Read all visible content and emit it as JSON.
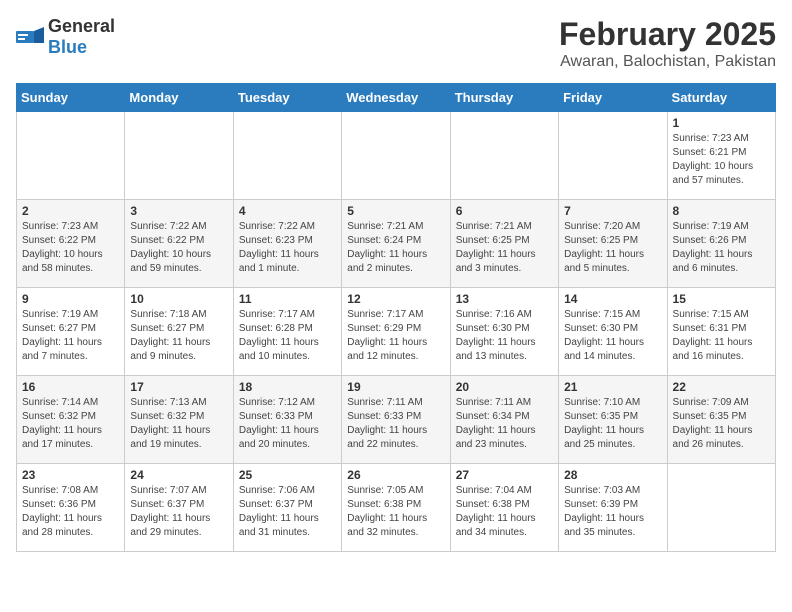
{
  "header": {
    "logo_general": "General",
    "logo_blue": "Blue",
    "main_title": "February 2025",
    "sub_title": "Awaran, Balochistan, Pakistan"
  },
  "weekdays": [
    "Sunday",
    "Monday",
    "Tuesday",
    "Wednesday",
    "Thursday",
    "Friday",
    "Saturday"
  ],
  "weeks": [
    [
      {
        "day": "",
        "info": ""
      },
      {
        "day": "",
        "info": ""
      },
      {
        "day": "",
        "info": ""
      },
      {
        "day": "",
        "info": ""
      },
      {
        "day": "",
        "info": ""
      },
      {
        "day": "",
        "info": ""
      },
      {
        "day": "1",
        "info": "Sunrise: 7:23 AM\nSunset: 6:21 PM\nDaylight: 10 hours\nand 57 minutes."
      }
    ],
    [
      {
        "day": "2",
        "info": "Sunrise: 7:23 AM\nSunset: 6:22 PM\nDaylight: 10 hours\nand 58 minutes."
      },
      {
        "day": "3",
        "info": "Sunrise: 7:22 AM\nSunset: 6:22 PM\nDaylight: 10 hours\nand 59 minutes."
      },
      {
        "day": "4",
        "info": "Sunrise: 7:22 AM\nSunset: 6:23 PM\nDaylight: 11 hours\nand 1 minute."
      },
      {
        "day": "5",
        "info": "Sunrise: 7:21 AM\nSunset: 6:24 PM\nDaylight: 11 hours\nand 2 minutes."
      },
      {
        "day": "6",
        "info": "Sunrise: 7:21 AM\nSunset: 6:25 PM\nDaylight: 11 hours\nand 3 minutes."
      },
      {
        "day": "7",
        "info": "Sunrise: 7:20 AM\nSunset: 6:25 PM\nDaylight: 11 hours\nand 5 minutes."
      },
      {
        "day": "8",
        "info": "Sunrise: 7:19 AM\nSunset: 6:26 PM\nDaylight: 11 hours\nand 6 minutes."
      }
    ],
    [
      {
        "day": "9",
        "info": "Sunrise: 7:19 AM\nSunset: 6:27 PM\nDaylight: 11 hours\nand 7 minutes."
      },
      {
        "day": "10",
        "info": "Sunrise: 7:18 AM\nSunset: 6:27 PM\nDaylight: 11 hours\nand 9 minutes."
      },
      {
        "day": "11",
        "info": "Sunrise: 7:17 AM\nSunset: 6:28 PM\nDaylight: 11 hours\nand 10 minutes."
      },
      {
        "day": "12",
        "info": "Sunrise: 7:17 AM\nSunset: 6:29 PM\nDaylight: 11 hours\nand 12 minutes."
      },
      {
        "day": "13",
        "info": "Sunrise: 7:16 AM\nSunset: 6:30 PM\nDaylight: 11 hours\nand 13 minutes."
      },
      {
        "day": "14",
        "info": "Sunrise: 7:15 AM\nSunset: 6:30 PM\nDaylight: 11 hours\nand 14 minutes."
      },
      {
        "day": "15",
        "info": "Sunrise: 7:15 AM\nSunset: 6:31 PM\nDaylight: 11 hours\nand 16 minutes."
      }
    ],
    [
      {
        "day": "16",
        "info": "Sunrise: 7:14 AM\nSunset: 6:32 PM\nDaylight: 11 hours\nand 17 minutes."
      },
      {
        "day": "17",
        "info": "Sunrise: 7:13 AM\nSunset: 6:32 PM\nDaylight: 11 hours\nand 19 minutes."
      },
      {
        "day": "18",
        "info": "Sunrise: 7:12 AM\nSunset: 6:33 PM\nDaylight: 11 hours\nand 20 minutes."
      },
      {
        "day": "19",
        "info": "Sunrise: 7:11 AM\nSunset: 6:33 PM\nDaylight: 11 hours\nand 22 minutes."
      },
      {
        "day": "20",
        "info": "Sunrise: 7:11 AM\nSunset: 6:34 PM\nDaylight: 11 hours\nand 23 minutes."
      },
      {
        "day": "21",
        "info": "Sunrise: 7:10 AM\nSunset: 6:35 PM\nDaylight: 11 hours\nand 25 minutes."
      },
      {
        "day": "22",
        "info": "Sunrise: 7:09 AM\nSunset: 6:35 PM\nDaylight: 11 hours\nand 26 minutes."
      }
    ],
    [
      {
        "day": "23",
        "info": "Sunrise: 7:08 AM\nSunset: 6:36 PM\nDaylight: 11 hours\nand 28 minutes."
      },
      {
        "day": "24",
        "info": "Sunrise: 7:07 AM\nSunset: 6:37 PM\nDaylight: 11 hours\nand 29 minutes."
      },
      {
        "day": "25",
        "info": "Sunrise: 7:06 AM\nSunset: 6:37 PM\nDaylight: 11 hours\nand 31 minutes."
      },
      {
        "day": "26",
        "info": "Sunrise: 7:05 AM\nSunset: 6:38 PM\nDaylight: 11 hours\nand 32 minutes."
      },
      {
        "day": "27",
        "info": "Sunrise: 7:04 AM\nSunset: 6:38 PM\nDaylight: 11 hours\nand 34 minutes."
      },
      {
        "day": "28",
        "info": "Sunrise: 7:03 AM\nSunset: 6:39 PM\nDaylight: 11 hours\nand 35 minutes."
      },
      {
        "day": "",
        "info": ""
      }
    ]
  ]
}
